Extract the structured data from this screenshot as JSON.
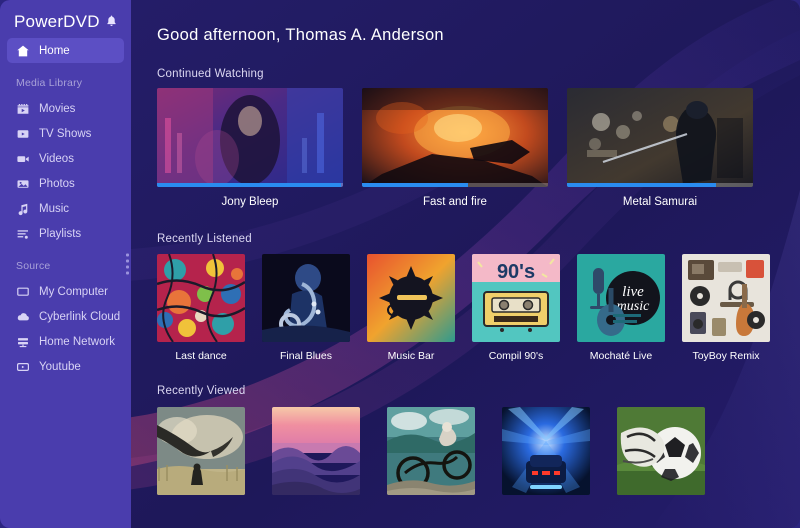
{
  "app": {
    "brand": "PowerDVD",
    "notification_icon": "bell-icon",
    "accent": "#2a8cf0",
    "sidebar_bg": "#4a3dad",
    "main_bg": "#201a5e",
    "active_item_bg": "#5c4fc4"
  },
  "sidebar": {
    "home": {
      "label": "Home",
      "icon": "home-icon",
      "active": true
    },
    "groups": [
      {
        "label": "Media Library",
        "items": [
          {
            "label": "Movies",
            "icon": "clapperboard-icon"
          },
          {
            "label": "TV Shows",
            "icon": "tv-icon"
          },
          {
            "label": "Videos",
            "icon": "video-camera-icon"
          },
          {
            "label": "Photos",
            "icon": "photo-icon"
          },
          {
            "label": "Music",
            "icon": "music-note-icon"
          },
          {
            "label": "Playlists",
            "icon": "playlist-icon"
          }
        ]
      },
      {
        "label": "Source",
        "items": [
          {
            "label": "My Computer",
            "icon": "monitor-icon"
          },
          {
            "label": "Cyberlink Cloud",
            "icon": "cloud-icon"
          },
          {
            "label": "Home Network",
            "icon": "network-icon"
          },
          {
            "label": "Youtube",
            "icon": "youtube-icon"
          }
        ]
      }
    ],
    "resize_handle": "drag-handle"
  },
  "main": {
    "greeting": "Good afternoon, Thomas A. Anderson",
    "sections": {
      "continued_watching": {
        "title": "Continued Watching",
        "items": [
          {
            "title": "Jony Bleep",
            "progress": 99,
            "art": "neon-city-man"
          },
          {
            "title": "Fast and fire",
            "progress": 57,
            "art": "fire-car-chase"
          },
          {
            "title": "Metal Samurai",
            "progress": 80,
            "art": "samurai-bokeh"
          }
        ]
      },
      "recently_listened": {
        "title": "Recently Listened",
        "items": [
          {
            "title": "Last dance",
            "art": "doodle-collage"
          },
          {
            "title": "Final Blues",
            "art": "saxophone-player"
          },
          {
            "title": "Music Bar",
            "art": "instrument-splash"
          },
          {
            "title": "Compil 90's",
            "art": "cassette-90s"
          },
          {
            "title": "Mochaté Live",
            "art": "live-music-guitar"
          },
          {
            "title": "ToyBoy Remix",
            "art": "gear-flatlay"
          }
        ]
      },
      "recently_viewed": {
        "title": "Recently Viewed",
        "items": [
          {
            "art": "eagle-field"
          },
          {
            "art": "pink-mountains"
          },
          {
            "art": "mountain-biker"
          },
          {
            "art": "blue-tunnel-car"
          },
          {
            "art": "soccer-ball-cleat"
          }
        ]
      }
    }
  }
}
